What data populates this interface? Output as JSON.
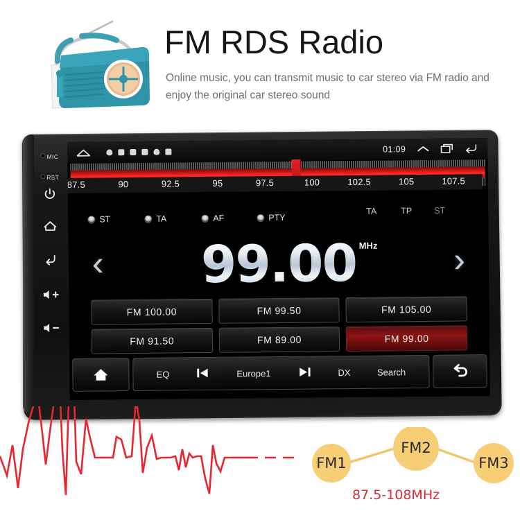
{
  "header": {
    "title": "FM RDS Radio",
    "subtitle": "Online music, you can transmit music to car stereo via FM radio and enjoy the original car stereo sound",
    "illustration": "retro-radio-illustration"
  },
  "device": {
    "side_buttons": [
      {
        "name": "mic",
        "label": "MIC",
        "type": "hole"
      },
      {
        "name": "reset",
        "label": "RST",
        "type": "hole"
      },
      {
        "name": "power",
        "label": "",
        "type": "power-icon"
      },
      {
        "name": "home",
        "label": "",
        "type": "home-icon"
      },
      {
        "name": "back",
        "label": "",
        "type": "back-icon"
      },
      {
        "name": "volume-up",
        "label": "",
        "type": "volume-up-icon"
      },
      {
        "name": "volume-down",
        "label": "",
        "type": "volume-down-icon"
      }
    ],
    "statusbar": {
      "clock": "01:09",
      "left_icons": [
        "home-outline-icon",
        "location-icon",
        "sd-card-icon",
        "usb-icon",
        "sim-icon",
        "bluetooth-icon",
        "battery-icon"
      ],
      "right_icons": [
        "chevron-up-icon",
        "recents-icon",
        "back-arrow-icon"
      ]
    },
    "tuner": {
      "scale_labels": [
        "87.5",
        "90",
        "92.5",
        "95",
        "97.5",
        "100",
        "102.5",
        "105",
        "107.5"
      ],
      "needle_frequency": "99.00",
      "range_min": 87.5,
      "range_max": 108.0
    },
    "rds": {
      "toggles": [
        {
          "label": "ST",
          "on": true
        },
        {
          "label": "TA",
          "on": true
        },
        {
          "label": "AF",
          "on": true
        },
        {
          "label": "PTY",
          "on": true
        }
      ],
      "indicators": [
        {
          "label": "TA",
          "active": true
        },
        {
          "label": "TP",
          "active": true
        },
        {
          "label": "ST",
          "active": false
        }
      ]
    },
    "display": {
      "frequency": "99.00",
      "unit": "MHz",
      "prev_icon": "chevron-left-icon",
      "next_icon": "chevron-right-icon"
    },
    "presets": [
      {
        "label": "FM  100.00",
        "active": false
      },
      {
        "label": "FM  99.50",
        "active": false
      },
      {
        "label": "FM  105.00",
        "active": false
      },
      {
        "label": "FM  91.50",
        "active": false
      },
      {
        "label": "FM  89.00",
        "active": false
      },
      {
        "label": "FM  99.00",
        "active": true
      }
    ],
    "bottom_bar": {
      "home_icon": "home-icon",
      "items": [
        {
          "label": "EQ",
          "icon": ""
        },
        {
          "label": "",
          "icon": "prev-track-icon"
        },
        {
          "label": "Europe1",
          "icon": ""
        },
        {
          "label": "",
          "icon": "next-track-icon"
        },
        {
          "label": "DX",
          "icon": ""
        },
        {
          "label": "Search",
          "icon": ""
        }
      ],
      "back_icon": "return-arrow-icon"
    }
  },
  "footer": {
    "nodes": [
      "FM1",
      "FM2",
      "FM3"
    ],
    "band_range": "87.5-108MHz",
    "waveform": "red-audio-waveform"
  },
  "colors": {
    "accent_red": "#e01c1c",
    "node_yellow": "#f7ce76",
    "band_text": "#d42b3a",
    "title_dark": "#161616",
    "subtitle_gray": "#6f6f6f"
  }
}
